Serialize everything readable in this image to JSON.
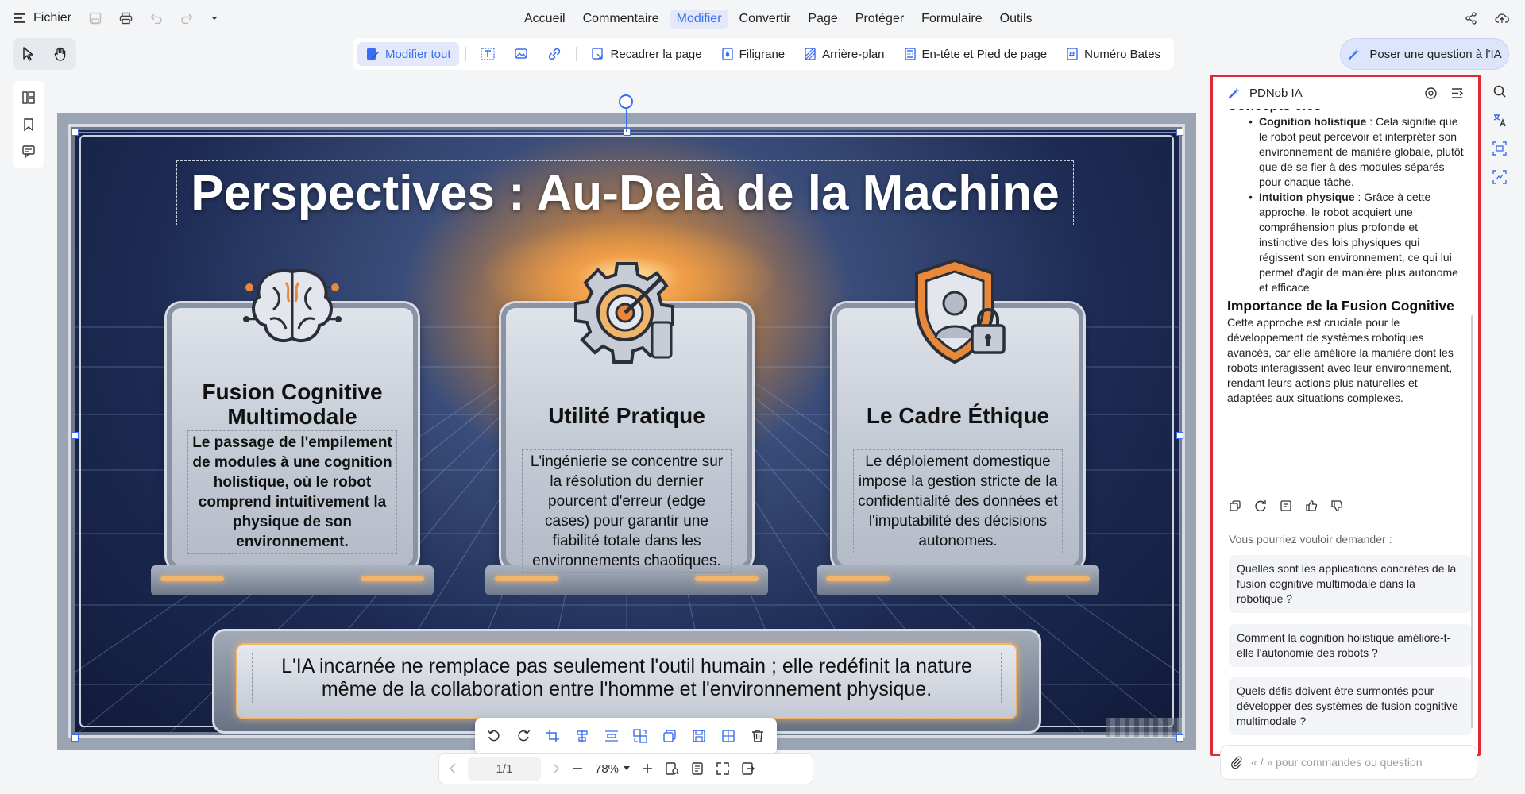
{
  "menubar": {
    "file_label": "Fichier",
    "menus": [
      {
        "label": "Accueil",
        "active": false
      },
      {
        "label": "Commentaire",
        "active": false
      },
      {
        "label": "Modifier",
        "active": true
      },
      {
        "label": "Convertir",
        "active": false
      },
      {
        "label": "Page",
        "active": false
      },
      {
        "label": "Protéger",
        "active": false
      },
      {
        "label": "Formulaire",
        "active": false
      },
      {
        "label": "Outils",
        "active": false
      }
    ]
  },
  "toolbar": {
    "edit_all": "Modifier tout",
    "crop_page": "Recadrer la page",
    "watermark": "Filigrane",
    "background": "Arrière-plan",
    "header_footer": "En-tête et Pied de page",
    "bates": "Numéro Bates",
    "ask_ai": "Poser une question à l'IA"
  },
  "slide": {
    "title": "Perspectives : Au-Delà de la Machine",
    "cards": [
      {
        "title": "Fusion Cognitive Multimodale",
        "body": "Le passage de l'empilement de modules à une cognition holistique, où le robot comprend intuitivement la physique de son environnement."
      },
      {
        "title": "Utilité Pratique",
        "body": "L'ingénierie se concentre sur la résolution du dernier pourcent d'erreur (edge cases) pour garantir une fiabilité totale dans les environnements chaotiques."
      },
      {
        "title": "Le Cadre Éthique",
        "body": "Le déploiement domestique impose la gestion stricte de la confidentialité des données et l'imputabilité des décisions autonomes."
      }
    ],
    "banner": "L'IA incarnée ne remplace pas seulement l'outil humain ; elle redéfinit la nature même de la collaboration entre l'homme et l'environnement physique."
  },
  "navigation": {
    "page": "1/1",
    "zoom": "78%"
  },
  "ai_panel": {
    "title": "PDNob IA",
    "heading1": "Concepts clés",
    "bullets": [
      {
        "term": "Cognition holistique",
        "text": " : Cela signifie que le robot peut percevoir et interpréter son environnement de manière globale, plutôt que de se fier à des modules séparés pour chaque tâche."
      },
      {
        "term": "Intuition physique",
        "text": " : Grâce à cette approche, le robot acquiert une compréhension plus profonde et instinctive des lois physiques qui régissent son environnement, ce qui lui permet d'agir de manière plus autonome et efficace."
      }
    ],
    "heading2": "Importance de la Fusion Cognitive",
    "paragraph": "Cette approche est cruciale pour le développement de systèmes robotiques avancés, car elle améliore la manière dont les robots interagissent avec leur environnement, rendant leurs actions plus naturelles et adaptées aux situations complexes.",
    "suggest_label": "Vous pourriez vouloir demander :",
    "suggestions": [
      "Quelles sont les applications concrètes de la fusion cognitive multimodale dans la robotique ?",
      "Comment la cognition holistique améliore-t-elle l'autonomie des robots ?",
      "Quels défis doivent être surmontés pour développer des systèmes de fusion cognitive multimodale ?"
    ],
    "input_placeholder": "« / » pour commandes ou question"
  },
  "colors": {
    "accent": "#3a6df0",
    "highlight_border": "#e02a33",
    "slide_gold": "#f0b56a"
  }
}
